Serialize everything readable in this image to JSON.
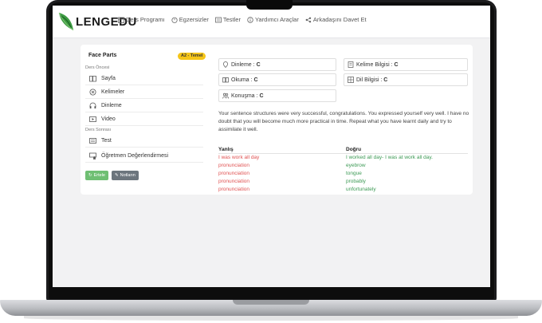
{
  "brand": {
    "name": "LENGEDU",
    "logo_icon": "leaf-logo-icon",
    "accent": "#4caf50"
  },
  "nav": {
    "items": [
      {
        "label": "Ders Programı",
        "icon": "calendar-icon"
      },
      {
        "label": "Egzersizler",
        "icon": "timer-icon"
      },
      {
        "label": "Testler",
        "icon": "list-icon"
      },
      {
        "label": "Yardımcı Araçlar",
        "icon": "info-icon"
      },
      {
        "label": "Arkadaşını Davet Et",
        "icon": "share-icon"
      }
    ]
  },
  "lesson": {
    "title": "Face Parts",
    "level": "A2 - Temel",
    "before_label": "Ders Öncesi",
    "before_items": [
      {
        "label": "Sayfa",
        "icon": "book-icon"
      },
      {
        "label": "Kelimeler",
        "icon": "circle-x-icon"
      },
      {
        "label": "Dinleme",
        "icon": "headphones-icon"
      },
      {
        "label": "Video",
        "icon": "video-icon"
      }
    ],
    "after_label": "Ders Sonrası",
    "after_items": [
      {
        "label": "Test",
        "icon": "list-icon"
      },
      {
        "label": "Öğretmen Değerlendirmesi",
        "icon": "teacher-icon"
      }
    ],
    "buttons": {
      "review": "Ertele",
      "notes": "Notların"
    }
  },
  "skills": [
    {
      "label": "Dinleme",
      "grade": "C",
      "icon": "pin-icon"
    },
    {
      "label": "Kelime Bilgisi",
      "grade": "C",
      "icon": "doc-icon"
    },
    {
      "label": "Okuma",
      "grade": "C",
      "icon": "book-icon"
    },
    {
      "label": "Dil Bilgisi",
      "grade": "C",
      "icon": "grid-icon"
    },
    {
      "label": "Konuşma",
      "grade": "C",
      "icon": "people-icon"
    }
  ],
  "feedback": "Your sentence structures were very successful, congratulations. You expressed yourself very well. I have no doubt that you will become much more practical in time. Repeat what you have learnt daily and try to assimilate it well.",
  "corrections": {
    "wrong_header": "Yanlış",
    "right_header": "Doğru",
    "wrong_color": "#e05252",
    "right_color": "#3d9a55",
    "rows": [
      {
        "wrong": "I was work all day",
        "right": "I worked all day- I was at work all day."
      },
      {
        "wrong": "pronunciation",
        "right": "eyebrow"
      },
      {
        "wrong": "pronunciation",
        "right": "tongue"
      },
      {
        "wrong": "pronunciation",
        "right": "probably"
      },
      {
        "wrong": "pronunciation",
        "right": "unfortunately"
      }
    ]
  }
}
